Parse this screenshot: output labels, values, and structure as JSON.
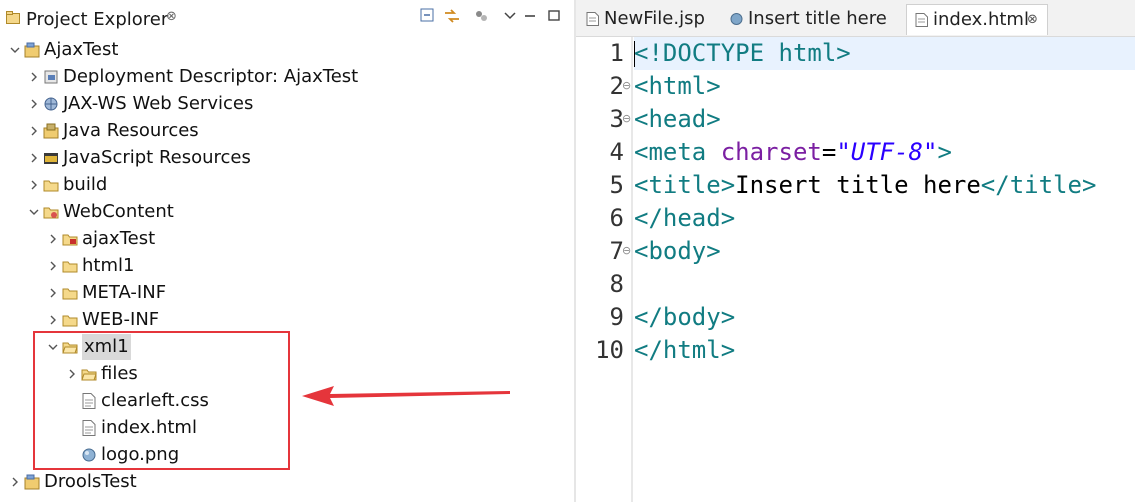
{
  "explorer": {
    "title": "Project Explorer",
    "close_glyph": "⊗",
    "tree": [
      {
        "label": "AjaxTest",
        "icon": "project-icon",
        "chevron": "open"
      },
      {
        "label": "Deployment Descriptor: AjaxTest",
        "icon": "deployment-descriptor-icon",
        "chevron": "closed"
      },
      {
        "label": "JAX-WS Web Services",
        "icon": "webservice-icon",
        "chevron": "closed"
      },
      {
        "label": "Java Resources",
        "icon": "java-resources-icon",
        "chevron": "closed"
      },
      {
        "label": "JavaScript Resources",
        "icon": "javascript-resources-icon",
        "chevron": "closed"
      },
      {
        "label": "build",
        "icon": "folder-icon",
        "chevron": "closed"
      },
      {
        "label": "WebContent",
        "icon": "webcontent-folder-icon",
        "chevron": "open"
      },
      {
        "label": "ajaxTest",
        "icon": "web-folder-icon",
        "chevron": "closed"
      },
      {
        "label": "html1",
        "icon": "folder-icon",
        "chevron": "closed"
      },
      {
        "label": "META-INF",
        "icon": "folder-icon",
        "chevron": "closed"
      },
      {
        "label": "WEB-INF",
        "icon": "folder-icon",
        "chevron": "closed"
      },
      {
        "label": "xml1",
        "icon": "folder-open-icon",
        "chevron": "open",
        "selected": true
      },
      {
        "label": "files",
        "icon": "folder-open-icon",
        "chevron": "closed"
      },
      {
        "label": "clearleft.css",
        "icon": "text-file-icon",
        "chevron": "none"
      },
      {
        "label": "index.html",
        "icon": "text-file-icon",
        "chevron": "none"
      },
      {
        "label": "logo.png",
        "icon": "image-file-icon",
        "chevron": "none"
      },
      {
        "label": "DroolsTest",
        "icon": "project-icon",
        "chevron": "closed"
      }
    ]
  },
  "editor": {
    "tabs": [
      {
        "label": "NewFile.jsp",
        "icon": "jsp-file-icon"
      },
      {
        "label": "Insert title here",
        "icon": "browser-icon"
      },
      {
        "label": "index.html",
        "icon": "html-file-icon",
        "active": true,
        "close_glyph": "⊗"
      }
    ],
    "line_numbers": [
      "1",
      "2",
      "3",
      "4",
      "5",
      "6",
      "7",
      "8",
      "9",
      "10"
    ],
    "lines": [
      [
        {
          "t": "<!DOCTYPE html>",
          "c": "tag"
        }
      ],
      [
        {
          "t": "<html>",
          "c": "tag"
        }
      ],
      [
        {
          "t": "<head>",
          "c": "tag"
        }
      ],
      [
        {
          "t": "<meta ",
          "c": "tag"
        },
        {
          "t": "charset",
          "c": "attr"
        },
        {
          "t": "=",
          "c": "txt"
        },
        {
          "t": "\"UTF-8\"",
          "c": "str"
        },
        {
          "t": ">",
          "c": "tag"
        }
      ],
      [
        {
          "t": "<title>",
          "c": "tag"
        },
        {
          "t": "Insert title here",
          "c": "txt"
        },
        {
          "t": "</title>",
          "c": "tag"
        }
      ],
      [
        {
          "t": "</head>",
          "c": "tag"
        }
      ],
      [
        {
          "t": "<body>",
          "c": "tag"
        }
      ],
      [],
      [
        {
          "t": "</body>",
          "c": "tag"
        }
      ],
      [
        {
          "t": "</html>",
          "c": "tag"
        }
      ]
    ],
    "fold_markers": [
      "2",
      "3",
      "7"
    ]
  },
  "colors": {
    "tag": "#117c82",
    "attribute": "#7b1fa2",
    "string": "#2a00ff",
    "highlight_box": "#e5353b",
    "current_line": "#e8f2fe"
  }
}
